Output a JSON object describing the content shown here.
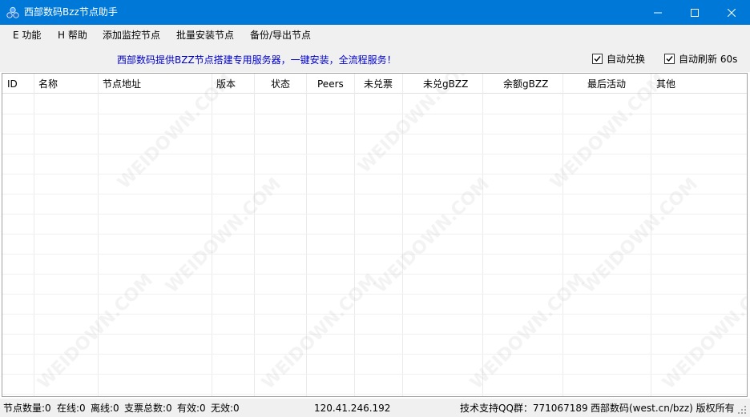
{
  "window": {
    "title": "西部数码Bzz节点助手",
    "accent_color": "#0078d7",
    "icon": "three-dots-logo-icon"
  },
  "menu": {
    "items": [
      {
        "label": "E 功能"
      },
      {
        "label": "H 帮助"
      },
      {
        "label": "添加监控节点"
      },
      {
        "label": "批量安装节点"
      },
      {
        "label": "备份/导出节点"
      }
    ]
  },
  "infobar": {
    "promo": "西部数码提供BZZ节点搭建专用服务器，一键安装，全流程服务！",
    "promo_color": "#0000cc",
    "auto_exchange": {
      "label": "自动兑换",
      "checked": true
    },
    "auto_refresh": {
      "label": "自动刷新 60s",
      "checked": true
    }
  },
  "table": {
    "columns": [
      "ID",
      "名称",
      "节点地址",
      "版本",
      "状态",
      "Peers",
      "未兑票",
      "未兑gBZZ",
      "余额gBZZ",
      "最后活动",
      "其他"
    ],
    "rows": []
  },
  "status": {
    "node_count": "节点数量:0",
    "online": "在线:0",
    "offline": "离线:0",
    "tickets_total": "支票总数:0",
    "valid": "有效:0",
    "invalid": "无效:0",
    "ip": "120.41.246.192",
    "support": "技术支持QQ群：771067189",
    "copyright": "西部数码(west.cn/bzz) 版权所有"
  },
  "watermark": "WEIDOWN.COM"
}
